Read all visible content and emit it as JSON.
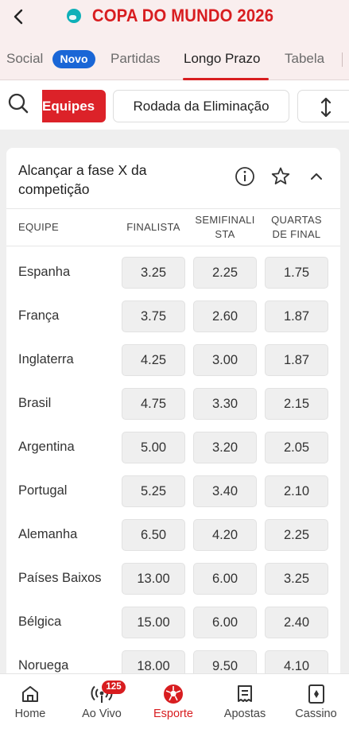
{
  "header": {
    "title": "COPA DO MUNDO 2026"
  },
  "tabs": [
    {
      "label": "Social",
      "active": false
    },
    {
      "label": "Partidas",
      "active": false
    },
    {
      "label": "Longo Prazo",
      "active": true
    },
    {
      "label": "Tabela",
      "active": false
    }
  ],
  "social_badge": "Novo",
  "filters": {
    "chips": [
      "Equipes",
      "Rodada da Eliminação"
    ]
  },
  "market": {
    "title": "Alcançar a fase X da competição",
    "columns": [
      "EQUIPE",
      "FINALISTA",
      "SEMIFINALI STA",
      "QUARTAS DE FINAL"
    ],
    "rows": [
      {
        "team": "Espanha",
        "odds": [
          "3.25",
          "2.25",
          "1.75"
        ]
      },
      {
        "team": "França",
        "odds": [
          "3.75",
          "2.60",
          "1.87"
        ]
      },
      {
        "team": "Inglaterra",
        "odds": [
          "4.25",
          "3.00",
          "1.87"
        ]
      },
      {
        "team": "Brasil",
        "odds": [
          "4.75",
          "3.30",
          "2.15"
        ]
      },
      {
        "team": "Argentina",
        "odds": [
          "5.00",
          "3.20",
          "2.05"
        ]
      },
      {
        "team": "Portugal",
        "odds": [
          "5.25",
          "3.40",
          "2.10"
        ]
      },
      {
        "team": "Alemanha",
        "odds": [
          "6.50",
          "4.20",
          "2.25"
        ]
      },
      {
        "team": "Países Baixos",
        "odds": [
          "13.00",
          "6.00",
          "3.25"
        ]
      },
      {
        "team": "Bélgica",
        "odds": [
          "15.00",
          "6.00",
          "2.40"
        ]
      },
      {
        "team": "Noruega",
        "odds": [
          "18.00",
          "9.50",
          "4.10"
        ]
      }
    ]
  },
  "bottom_nav": {
    "items": [
      {
        "label": "Home",
        "icon": "home-icon"
      },
      {
        "label": "Ao Vivo",
        "icon": "live-broadcast-icon"
      },
      {
        "label": "Esporte",
        "icon": "soccer-ball-icon",
        "active": true
      },
      {
        "label": "Apostas",
        "icon": "bet-slip-icon"
      },
      {
        "label": "Cassino",
        "icon": "playing-card-icon"
      }
    ],
    "live_count": "125"
  },
  "colors": {
    "brand_red": "#d81d20",
    "badge_blue": "#1a66d6",
    "odds_bg": "#efefef"
  }
}
